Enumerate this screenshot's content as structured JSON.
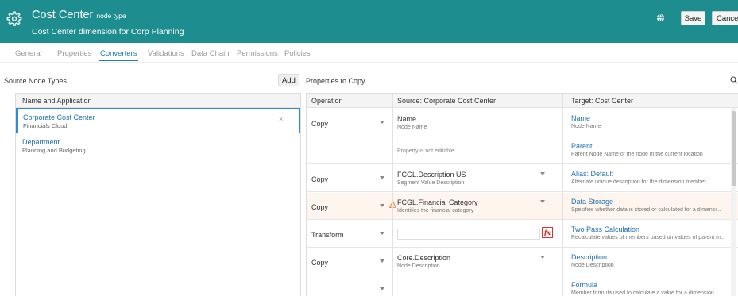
{
  "header": {
    "title": "Cost Center",
    "type_label": "node type",
    "subtitle": "Cost Center dimension for Corp Planning",
    "save_label": "Save",
    "cancel_label": "Cancel",
    "bg_color": "#1e8d8f"
  },
  "tabs": [
    {
      "label": "General"
    },
    {
      "label": "Properties"
    },
    {
      "label": "Converters"
    },
    {
      "label": "Validations"
    },
    {
      "label": "Data Chain"
    },
    {
      "label": "Permissions"
    },
    {
      "label": "Policies"
    }
  ],
  "active_tab": "Converters",
  "source_panel": {
    "title": "Source Node Types",
    "add_label": "Add",
    "column_header": "Name and Application",
    "items": [
      {
        "name": "Corporate Cost Center",
        "app": "Financials Cloud",
        "close": "×"
      },
      {
        "name": "Department",
        "app": "Planning and Budgeting"
      }
    ]
  },
  "copy_panel": {
    "title": "Properties to Copy",
    "columns": {
      "operation": "Operation",
      "source": "Source: Corporate Cost Center",
      "target": "Target: Cost Center"
    },
    "rows": [
      {
        "operation": "Copy",
        "src_name": "Name",
        "src_desc": "Node Name",
        "tgt_name": "Name",
        "tgt_desc": "Node Name"
      },
      {
        "operation": "",
        "src_note": "Property is not editable",
        "tgt_name": "Parent",
        "tgt_desc": "Parent Node Name of the node in the current location"
      },
      {
        "operation": "Copy",
        "src_name": "FCGL.Description US",
        "src_desc": "Segment Value Description",
        "tgt_name": "Alias: Default",
        "tgt_desc": "Alternate unique description for the dimension member."
      },
      {
        "operation": "Copy",
        "src_name": "FCGL.Financial Category",
        "src_desc": "Identifies the financial category",
        "tgt_name": "Data Storage",
        "tgt_desc": "Specifies whether data is stored or calculated for a dimensi..."
      },
      {
        "operation": "Transform",
        "fx": "fx",
        "tgt_name": "Two Pass Calculation",
        "tgt_desc": "Recalculate values of members based on values of parent m..."
      },
      {
        "operation": "Copy",
        "src_name": "Core.Description",
        "src_desc": "Node Description",
        "tgt_name": "Description",
        "tgt_desc": "Node Description"
      },
      {
        "operation": "",
        "tgt_name": "Formula",
        "tgt_desc": "Member formula used to calculate a value for a dimension ..."
      }
    ]
  }
}
